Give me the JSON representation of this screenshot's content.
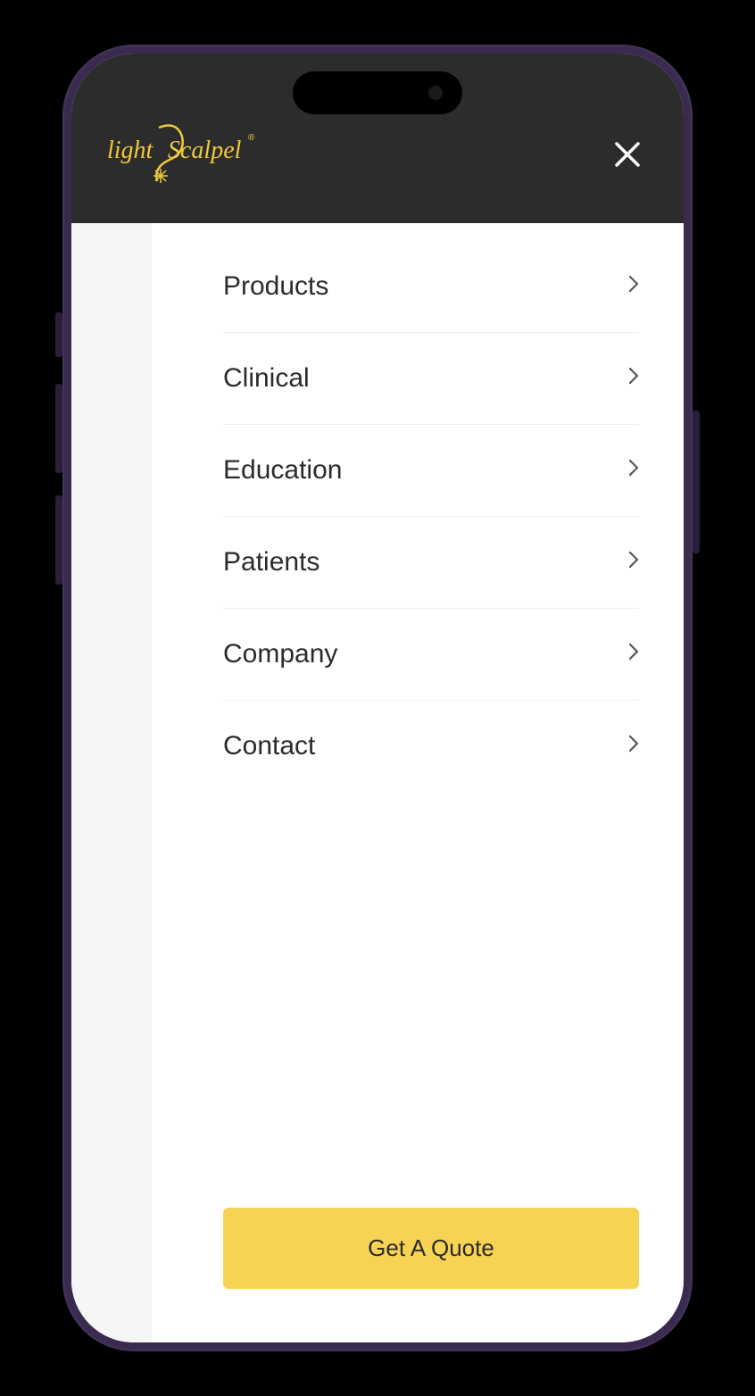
{
  "brand": {
    "name_part1": "light",
    "name_part2": "Scalpel",
    "trademark": "®",
    "accent_color": "#f0c93e"
  },
  "header": {
    "close_label": "Close menu"
  },
  "menu": {
    "items": [
      {
        "label": "Products"
      },
      {
        "label": "Clinical"
      },
      {
        "label": "Education"
      },
      {
        "label": "Patients"
      },
      {
        "label": "Company"
      },
      {
        "label": "Contact"
      }
    ]
  },
  "cta": {
    "label": "Get A Quote"
  },
  "colors": {
    "header_bg": "#2c2c2c",
    "cta_bg": "#f7d354",
    "text": "#2b2b2b"
  }
}
